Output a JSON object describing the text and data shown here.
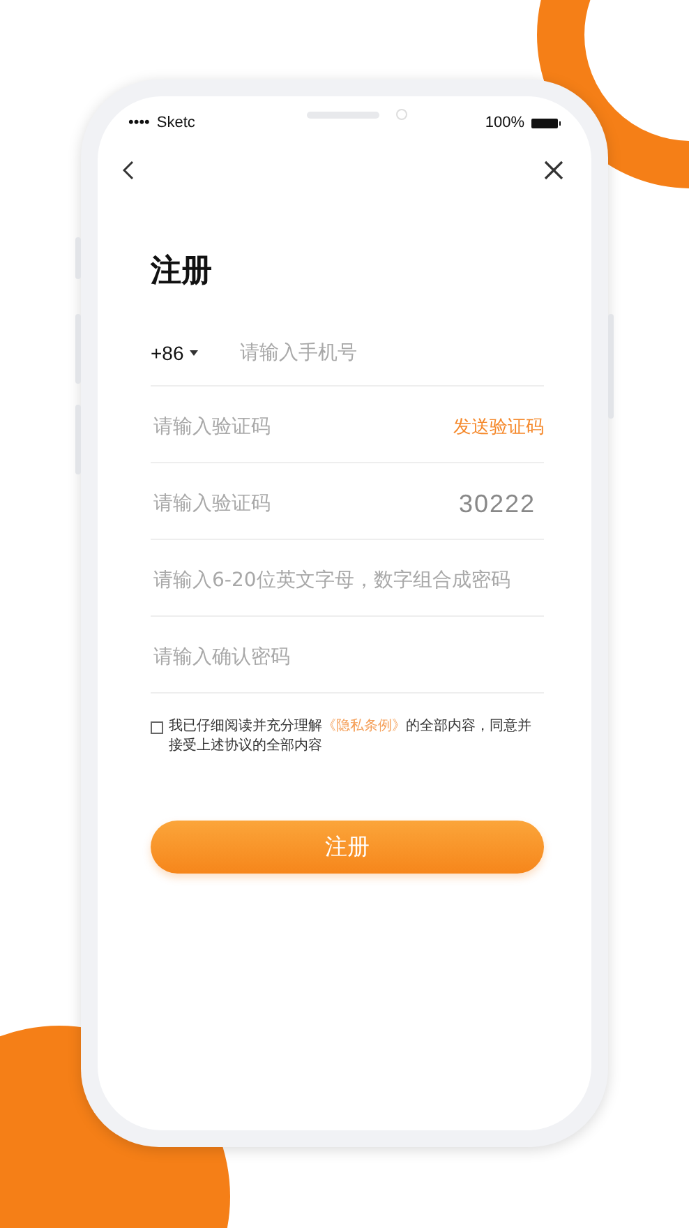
{
  "status_bar": {
    "signal": "••••",
    "carrier": "Sketc",
    "battery": "100%"
  },
  "title": "注册",
  "fields": [
    {
      "kind": "phone",
      "prefix": "+86",
      "placeholder": "请输入手机号"
    },
    {
      "kind": "code",
      "placeholder": "请输入验证码",
      "action": "发送验证码"
    },
    {
      "kind": "captcha",
      "placeholder": "请输入验证码",
      "captcha": "30222"
    },
    {
      "kind": "plain",
      "placeholder": "请输入6-20位英文字母，数字组合成密码"
    },
    {
      "kind": "plain",
      "placeholder": "请输入确认密码"
    }
  ],
  "agreement": {
    "checked": false,
    "before": "我已仔细阅读并充分理解",
    "link": "《隐私条例》",
    "after": "的全部内容，同意并接受上述协议的全部内容"
  },
  "submit": "注册"
}
